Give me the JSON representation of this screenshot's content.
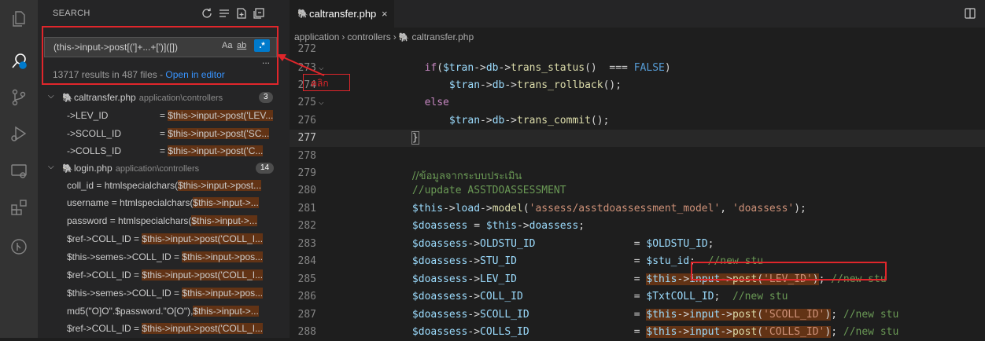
{
  "sidebar": {
    "title": "SEARCH",
    "search_query": "(this->input->post[(']+...+[')]([])",
    "options": {
      "match_case": "Aa",
      "whole_word": "ab",
      "regex": ".*"
    },
    "more": "...",
    "summary": "13717 results in 487 files - ",
    "open_in_editor": "Open in editor",
    "files": [
      {
        "name": "caltransfer.php",
        "path": "application\\controllers",
        "count": "3",
        "matches": [
          {
            "pre": "->LEV_ID",
            "mid": "= ",
            "hl": "$this->input->post('LEV..."
          },
          {
            "pre": "->SCOLL_ID",
            "mid": "= ",
            "hl": "$this->input->post('SC..."
          },
          {
            "pre": "->COLLS_ID",
            "mid": "= ",
            "hl": "$this->input->post('C..."
          }
        ]
      },
      {
        "name": "login.php",
        "path": "application\\controllers",
        "count": "14",
        "matches": [
          {
            "pre": "coll_id = htmlspecialchars(",
            "hl": "$this->input->post..."
          },
          {
            "pre": "username = htmlspecialchars(",
            "hl": "$this->input->..."
          },
          {
            "pre": "password = htmlspecialchars(",
            "hl": "$this->input->..."
          },
          {
            "pre": "$ref->COLL_ID = ",
            "hl": "$this->input->post('COLL_I..."
          },
          {
            "pre": "$this->semes->COLL_ID = ",
            "hl": "$this->input->pos..."
          },
          {
            "pre": "$ref->COLL_ID = ",
            "hl": "$this->input->post('COLL_I..."
          },
          {
            "pre": "$this->semes->COLL_ID = ",
            "hl": "$this->input->pos..."
          },
          {
            "pre": "md5(\"O]O\".$password.\"O[O\"),",
            "hl": "$this->input->..."
          },
          {
            "pre": "$ref->COLL_ID = ",
            "hl": "$this->input->post('COLL_I..."
          }
        ]
      }
    ]
  },
  "editor": {
    "tab": {
      "label": "caltransfer.php",
      "close": "×"
    },
    "breadcrumb": [
      "application",
      "controllers",
      "caltransfer.php"
    ],
    "callout": "คลิก",
    "lines": [
      "272",
      "273",
      "274",
      "275",
      "276",
      "277",
      "278",
      "279",
      "280",
      "281",
      "282",
      "283",
      "284",
      "285",
      "286",
      "287",
      "288"
    ]
  },
  "colors": {
    "accent": "#007acc",
    "annotation": "#e0262b",
    "match_highlight": "#623315"
  }
}
